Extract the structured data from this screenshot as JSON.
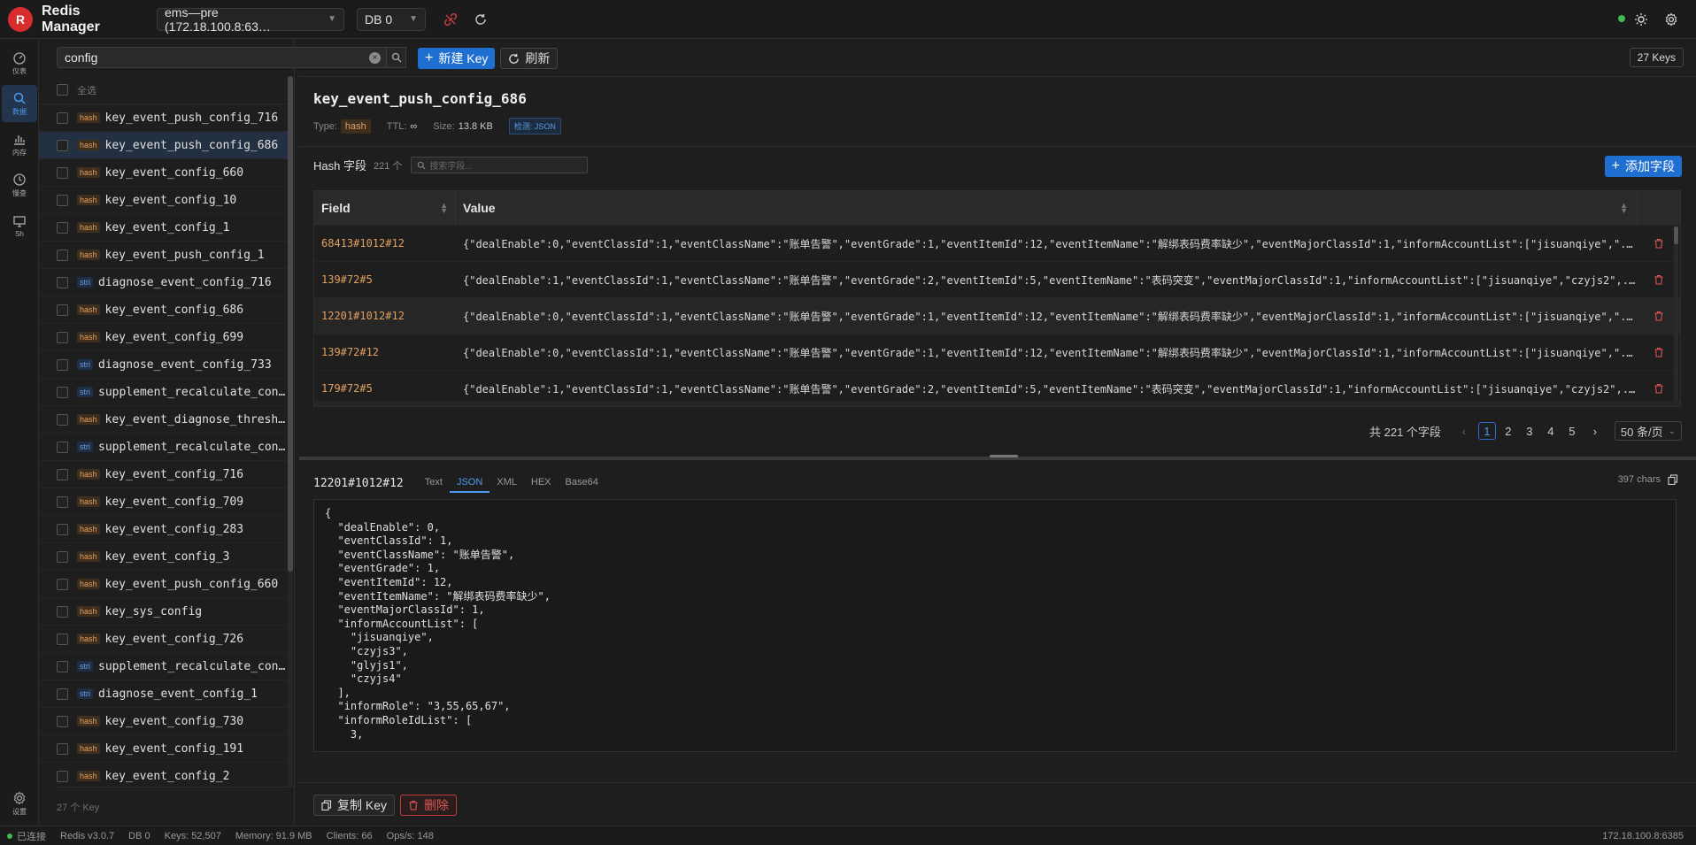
{
  "app": {
    "logo_letter": "R",
    "title": "Redis Manager",
    "connection": "ems—pre (172.18.100.8:63…",
    "db": "DB 0"
  },
  "nav": [
    {
      "label": "仪表",
      "icon": "dashboard-icon"
    },
    {
      "label": "数据",
      "icon": "search-icon",
      "active": true
    },
    {
      "label": "内存",
      "icon": "bar-chart-icon"
    },
    {
      "label": "慢查",
      "icon": "clock-icon"
    },
    {
      "label": "Sh",
      "icon": "monitor-icon"
    }
  ],
  "nav_settings_label": "设置",
  "search": {
    "value": "config",
    "new_key_label": "新建 Key",
    "refresh_label": "刷新",
    "keys_total": "27 Keys"
  },
  "keylist": {
    "select_all": "全选",
    "items": [
      {
        "type": "hash",
        "name": "key_event_push_config_716"
      },
      {
        "type": "hash",
        "name": "key_event_push_config_686",
        "selected": true
      },
      {
        "type": "hash",
        "name": "key_event_config_660"
      },
      {
        "type": "hash",
        "name": "key_event_config_10"
      },
      {
        "type": "hash",
        "name": "key_event_config_1"
      },
      {
        "type": "hash",
        "name": "key_event_push_config_1"
      },
      {
        "type": "stri",
        "name": "diagnose_event_config_716"
      },
      {
        "type": "hash",
        "name": "key_event_config_686"
      },
      {
        "type": "hash",
        "name": "key_event_config_699"
      },
      {
        "type": "stri",
        "name": "diagnose_event_config_733"
      },
      {
        "type": "stri",
        "name": "supplement_recalculate_con…"
      },
      {
        "type": "hash",
        "name": "key_event_diagnose_thresh…"
      },
      {
        "type": "stri",
        "name": "supplement_recalculate_con…"
      },
      {
        "type": "hash",
        "name": "key_event_config_716"
      },
      {
        "type": "hash",
        "name": "key_event_config_709"
      },
      {
        "type": "hash",
        "name": "key_event_config_283"
      },
      {
        "type": "hash",
        "name": "key_event_config_3"
      },
      {
        "type": "hash",
        "name": "key_event_push_config_660"
      },
      {
        "type": "hash",
        "name": "key_sys_config"
      },
      {
        "type": "hash",
        "name": "key_event_config_726"
      },
      {
        "type": "stri",
        "name": "supplement_recalculate_con…"
      },
      {
        "type": "stri",
        "name": "diagnose_event_config_1"
      },
      {
        "type": "hash",
        "name": "key_event_config_730"
      },
      {
        "type": "hash",
        "name": "key_event_config_191"
      },
      {
        "type": "hash",
        "name": "key_event_config_2"
      }
    ],
    "count_label": "27 个 Key"
  },
  "detail": {
    "key": "key_event_push_config_686",
    "type_label": "Type:",
    "type": "hash",
    "ttl_label": "TTL:",
    "ttl": "∞",
    "size_label": "Size:",
    "size": "13.8 KB",
    "detect": "检测: JSON",
    "hash_title": "Hash 字段",
    "hash_count": "221 个",
    "field_search_placeholder": "搜索字段...",
    "add_field": "添加字段",
    "col_field": "Field",
    "col_value": "Value",
    "rows": [
      {
        "field": "68413#1012#12",
        "value": "{\"dealEnable\":0,\"eventClassId\":1,\"eventClassName\":\"账单告警\",\"eventGrade\":1,\"eventItemId\":12,\"eventItemName\":\"解绑表码费率缺少\",\"eventMajorClassId\":1,\"informAccountList\":[\"jisuanqiye\",\"..."
      },
      {
        "field": "139#72#5",
        "value": "{\"dealEnable\":1,\"eventClassId\":1,\"eventClassName\":\"账单告警\",\"eventGrade\":2,\"eventItemId\":5,\"eventItemName\":\"表码突变\",\"eventMajorClassId\":1,\"informAccountList\":[\"jisuanqiye\",\"czyjs2\",..."
      },
      {
        "field": "12201#1012#12",
        "value": "{\"dealEnable\":0,\"eventClassId\":1,\"eventClassName\":\"账单告警\",\"eventGrade\":1,\"eventItemId\":12,\"eventItemName\":\"解绑表码费率缺少\",\"eventMajorClassId\":1,\"informAccountList\":[\"jisuanqiye\",\"...",
        "highlight": true
      },
      {
        "field": "139#72#12",
        "value": "{\"dealEnable\":0,\"eventClassId\":1,\"eventClassName\":\"账单告警\",\"eventGrade\":1,\"eventItemId\":12,\"eventItemName\":\"解绑表码费率缺少\",\"eventMajorClassId\":1,\"informAccountList\":[\"jisuanqiye\",\"..."
      },
      {
        "field": "179#72#5",
        "value": "{\"dealEnable\":1,\"eventClassId\":1,\"eventClassName\":\"账单告警\",\"eventGrade\":2,\"eventItemId\":5,\"eventItemName\":\"表码突变\",\"eventMajorClassId\":1,\"informAccountList\":[\"jisuanqiye\",\"czyjs2\",..."
      }
    ],
    "pager": {
      "total": "共 221 个字段",
      "pages": [
        "1",
        "2",
        "3",
        "4",
        "5"
      ],
      "current": "1",
      "page_size": "50 条/页"
    },
    "viewer": {
      "field": "12201#1012#12",
      "tabs": [
        "Text",
        "JSON",
        "XML",
        "HEX",
        "Base64"
      ],
      "active_tab": "JSON",
      "chars": "397 chars",
      "json": "{\n  \"dealEnable\": 0,\n  \"eventClassId\": 1,\n  \"eventClassName\": \"账单告警\",\n  \"eventGrade\": 1,\n  \"eventItemId\": 12,\n  \"eventItemName\": \"解绑表码费率缺少\",\n  \"eventMajorClassId\": 1,\n  \"informAccountList\": [\n    \"jisuanqiye\",\n    \"czyjs3\",\n    \"glyjs1\",\n    \"czyjs4\"\n  ],\n  \"informRole\": \"3,55,65,67\",\n  \"informRoleIdList\": [\n    3,"
    },
    "copy_key": "复制 Key",
    "delete": "删除"
  },
  "status": {
    "connected": "已连接",
    "version": "Redis v3.0.7",
    "db": "DB 0",
    "keys": "Keys: 52,507",
    "memory": "Memory: 91.9 MB",
    "clients": "Clients: 66",
    "ops": "Ops/s: 148",
    "host": "172.18.100.8:6385"
  },
  "colors": {
    "accent": "#1f6fd0",
    "hash_badge": "#e0a060",
    "string_badge": "#6b9be0",
    "danger": "#e05555",
    "connected": "#3fb950"
  }
}
